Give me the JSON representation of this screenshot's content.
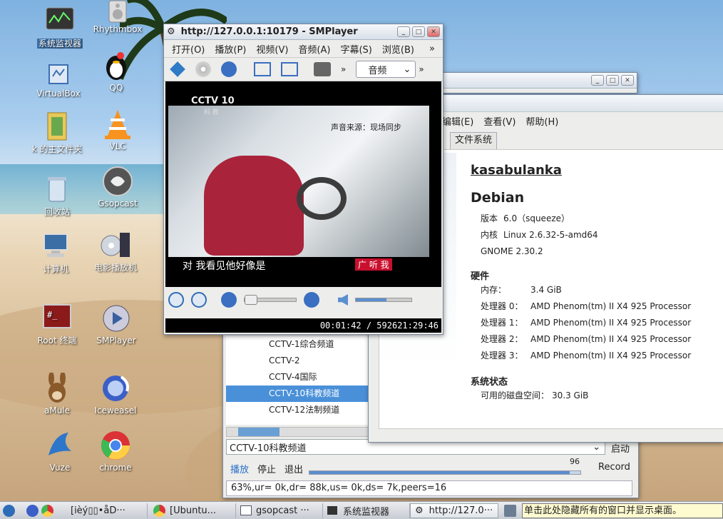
{
  "desktop": {
    "icons": [
      {
        "label": "系统监视器",
        "icon": "system-monitor-icon"
      },
      {
        "label": "Rhythmbox",
        "icon": "rhythmbox-icon"
      },
      {
        "label": "VirtualBox",
        "icon": "virtualbox-icon"
      },
      {
        "label": "QQ",
        "icon": "qq-penguin-icon"
      },
      {
        "label": "k 的主文件夹",
        "icon": "home-folder-icon"
      },
      {
        "label": "VLC",
        "icon": "vlc-cone-icon"
      },
      {
        "label": "回收站",
        "icon": "trash-icon"
      },
      {
        "label": "Gsopcast",
        "icon": "gsopcast-icon"
      },
      {
        "label": "计算机",
        "icon": "computer-icon"
      },
      {
        "label": "电影播放机",
        "icon": "movie-player-icon"
      },
      {
        "label": "Root 终端",
        "icon": "terminal-icon"
      },
      {
        "label": "SMPlayer",
        "icon": "smplayer-icon"
      },
      {
        "label": "aMule",
        "icon": "amule-icon"
      },
      {
        "label": "Iceweasel",
        "icon": "iceweasel-icon"
      },
      {
        "label": "Vuze",
        "icon": "vuze-icon"
      },
      {
        "label": "chrome",
        "icon": "chrome-icon"
      }
    ]
  },
  "smplayer": {
    "title": "http://127.0.0.1:10179 - SMPlayer",
    "menu": [
      "打开(O)",
      "播放(P)",
      "视频(V)",
      "音频(A)",
      "字幕(S)",
      "浏览(B)"
    ],
    "more": "»",
    "audio_select": "音频",
    "video": {
      "channel_logo": "CCTV 10",
      "channel_sub": "科 教",
      "caption_top": "声音来源：现场同步",
      "subtitle": "对 我看见他好像是",
      "show_logo": "广 听 我"
    },
    "time": "00:01:42 / 592621:29:46",
    "volume_level": 0.55,
    "seek_level": 0.0
  },
  "sysmon": {
    "menu": [
      "编辑(E)",
      "查看(V)",
      "帮助(H)"
    ],
    "tab": "文件系统",
    "hostname": "kasabulanka",
    "os": "Debian",
    "version_key": "版本",
    "version_val": "6.0（squeeze）",
    "kernel_key": "内核",
    "kernel_val": "Linux 2.6.32-5-amd64",
    "gnome": "GNOME 2.30.2",
    "hw_title": "硬件",
    "mem_key": "内存：",
    "mem_val": "3.4 GiB",
    "cpus": [
      {
        "k": "处理器 0：",
        "v": "AMD Phenom(tm) II X4 925 Processor"
      },
      {
        "k": "处理器 1：",
        "v": "AMD Phenom(tm) II X4 925 Processor"
      },
      {
        "k": "处理器 2：",
        "v": "AMD Phenom(tm) II X4 925 Processor"
      },
      {
        "k": "处理器 3：",
        "v": "AMD Phenom(tm) II X4 925 Processor"
      }
    ],
    "status_title": "系统状态",
    "disk_key": "可用的磁盘空间：",
    "disk_val": "30.3 GiB"
  },
  "gsopcast": {
    "channels": [
      "CCTV-1综合频道",
      "CCTV-2",
      "CCTV-4国际",
      "CCTV-10科教频道",
      "CCTV-12法制频道"
    ],
    "selected_index": 3,
    "combo": "CCTV-10科教频道",
    "start_btn": "启动",
    "play_btn": "播放",
    "stop_btn": "停止",
    "quit_btn": "退出",
    "volume": "96",
    "record": "Record",
    "volume_level": 0.96,
    "status": "63%,ur= 0k,dr= 88k,us= 0k,ds= 7k,peers=16"
  },
  "taskbar": {
    "tasks": [
      "[ièý▯▯•åD···",
      "[Ubuntu...",
      "gsopcast ···",
      "系统监视器",
      "http://127.0···"
    ],
    "hint": "单击此处隐藏所有的窗口并显示桌面。"
  },
  "colors": {
    "selection": "#3a6ea5",
    "accent": "#4a90d9"
  }
}
